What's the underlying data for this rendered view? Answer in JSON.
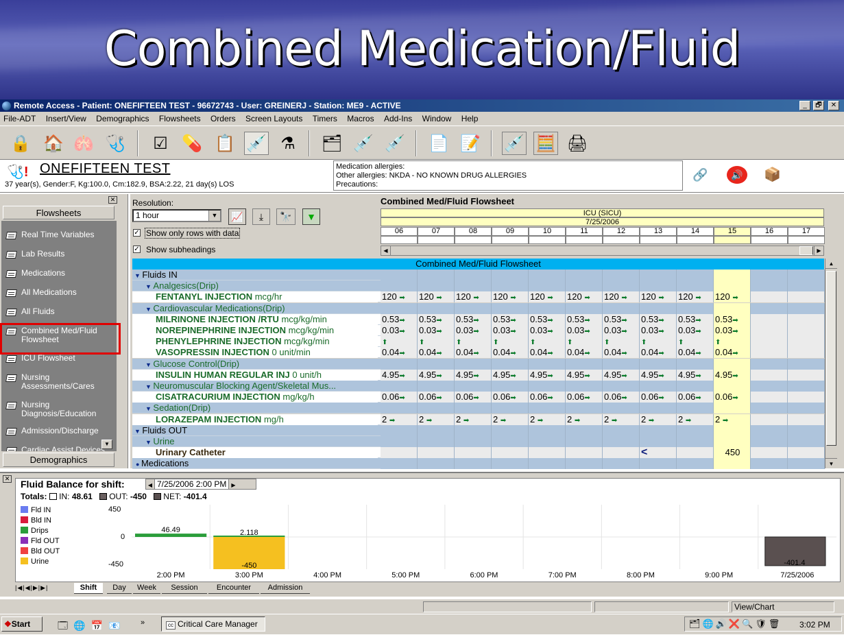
{
  "slide": {
    "title": "Combined Medication/Fluid"
  },
  "window": {
    "title": "Remote Access - Patient: ONEFIFTEEN TEST - 96672743 - User: GREINERJ - Station: ME9 - ACTIVE",
    "min": "_",
    "max": "🗗",
    "close": "✕"
  },
  "menu": [
    "File-ADT",
    "Insert/View",
    "Demographics",
    "Flowsheets",
    "Orders",
    "Screen Layouts",
    "Timers",
    "Macros",
    "Add-Ins",
    "Window",
    "Help"
  ],
  "toolbar_icons": [
    {
      "name": "lock-icon",
      "glyph": "🔒"
    },
    {
      "name": "home-icon",
      "glyph": "🏠"
    },
    {
      "name": "lungs-icon",
      "glyph": "🫁"
    },
    {
      "name": "stethoscope-icon",
      "glyph": "🩺"
    },
    {
      "name": "checklist-icon",
      "glyph": "☑"
    },
    {
      "name": "pills-icon",
      "glyph": "💊"
    },
    {
      "name": "schedule-icon",
      "glyph": "📋"
    },
    {
      "name": "iv-icon",
      "glyph": "💉"
    },
    {
      "name": "lab-flask-icon",
      "glyph": "⚗"
    },
    {
      "name": "cards-icon",
      "glyph": "🗂"
    },
    {
      "name": "syringe-icon",
      "glyph": "💉"
    },
    {
      "name": "syringe-red-icon",
      "glyph": "💉"
    },
    {
      "name": "document-person-icon",
      "glyph": "📄"
    },
    {
      "name": "note-icon",
      "glyph": "📝"
    },
    {
      "name": "injection-icon",
      "glyph": "💉"
    },
    {
      "name": "calculator-icon",
      "glyph": "🧮"
    },
    {
      "name": "printer-icon",
      "glyph": "🖨"
    }
  ],
  "patient": {
    "name": "ONEFIFTEEN TEST",
    "info": "37 year(s), Gender:F, Kg:100.0, Cm:182.9, BSA:2.22, 21 day(s) LOS",
    "allergy_line1": "Medication allergies:",
    "allergy_line2": "Other allergies:  NKDA - NO KNOWN DRUG ALLERGIES",
    "allergy_line3": "Precautions:"
  },
  "sidebar": {
    "header": "Flowsheets",
    "items": [
      {
        "label": "Real Time Variables"
      },
      {
        "label": "Lab Results"
      },
      {
        "label": "Medications"
      },
      {
        "label": "All Medications"
      },
      {
        "label": "All Fluids"
      },
      {
        "label": "Combined Med/Fluid\nFlowsheet"
      },
      {
        "label": "ICU Flowsheet"
      },
      {
        "label": "Nursing\nAssessments/Cares"
      },
      {
        "label": "Nursing\nDiagnosis/Education"
      },
      {
        "label": "Admission/Discharge"
      },
      {
        "label": "Cardiac Assist Devices"
      }
    ],
    "footer": "Demographics"
  },
  "controls": {
    "resolution_label": "Resolution:",
    "resolution_value": "1 hour",
    "show_rows": "Show only rows with data",
    "show_subheadings": "Show subheadings",
    "checked": "✓"
  },
  "grid": {
    "title": "Combined Med/Fluid Flowsheet",
    "unit": "ICU (SICU)",
    "date": "7/25/2006",
    "hours": [
      "06",
      "07",
      "08",
      "09",
      "10",
      "11",
      "12",
      "13",
      "14",
      "15",
      "16",
      "17"
    ],
    "banner": "Combined Med/Fluid Flowsheet",
    "rows": [
      {
        "type": "group",
        "label": "Fluids IN",
        "values": []
      },
      {
        "type": "sub",
        "label": "Analgesics(Drip)",
        "values": []
      },
      {
        "type": "drug",
        "label": "FENTANYL INJECTION",
        "unit": " mcg/hr",
        "values": [
          "120 ➡",
          "120 ➡",
          "120 ➡",
          "120 ➡",
          "120 ➡",
          "120 ➡",
          "120 ➡",
          "120 ➡",
          "120 ➡",
          "120 ➡",
          "",
          ""
        ]
      },
      {
        "type": "sub",
        "label": "Cardiovascular Medications(Drip)",
        "values": []
      },
      {
        "type": "drug",
        "label": "MILRINONE INJECTION /RTU",
        "unit": " mcg/kg/min",
        "values": [
          "0.53➡",
          "0.53➡",
          "0.53➡",
          "0.53➡",
          "0.53➡",
          "0.53➡",
          "0.53➡",
          "0.53➡",
          "0.53➡",
          "0.53➡",
          "",
          ""
        ]
      },
      {
        "type": "drug",
        "label": "NOREPINEPHRINE INJECTION",
        "unit": " mcg/kg/min",
        "values": [
          "0.03➡",
          "0.03➡",
          "0.03➡",
          "0.03➡",
          "0.03➡",
          "0.03➡",
          "0.03➡",
          "0.03➡",
          "0.03➡",
          "0.03➡",
          "",
          ""
        ]
      },
      {
        "type": "drug",
        "label": "PHENYLEPHRINE INJECTION",
        "unit": " mcg/kg/min",
        "values": [
          "  ⬆",
          "  ⬆",
          "  ⬆",
          "  ⬆",
          "  ⬆",
          "  ⬆",
          "  ⬆",
          "  ⬆",
          "  ⬆",
          "  ⬆",
          "",
          ""
        ]
      },
      {
        "type": "drug",
        "label": "VASOPRESSIN INJECTION",
        "unit": " 0 unit/min",
        "values": [
          "0.04➡",
          "0.04➡",
          "0.04➡",
          "0.04➡",
          "0.04➡",
          "0.04➡",
          "0.04➡",
          "0.04➡",
          "0.04➡",
          "0.04➡",
          "",
          ""
        ]
      },
      {
        "type": "sub",
        "label": "Glucose Control(Drip)",
        "values": []
      },
      {
        "type": "drug",
        "label": "INSULIN HUMAN REGULAR INJ",
        "unit": " 0 unit/h",
        "values": [
          "4.95➡",
          "4.95➡",
          "4.95➡",
          "4.95➡",
          "4.95➡",
          "4.95➡",
          "4.95➡",
          "4.95➡",
          "4.95➡",
          "4.95➡",
          "",
          ""
        ]
      },
      {
        "type": "sub",
        "label": "Neuromuscular Blocking Agent/Skeletal Mus...",
        "values": []
      },
      {
        "type": "drug",
        "label": "CISATRACURIUM INJECTION",
        "unit": " mg/kg/h",
        "values": [
          "0.06➡",
          "0.06➡",
          "0.06➡",
          "0.06➡",
          "0.06➡",
          "0.06➡",
          "0.06➡",
          "0.06➡",
          "0.06➡",
          "0.06➡",
          "",
          ""
        ]
      },
      {
        "type": "sub",
        "label": "Sedation(Drip)",
        "values": []
      },
      {
        "type": "drug",
        "label": "LORAZEPAM INJECTION",
        "unit": " mg/h",
        "values": [
          "2   ➡",
          "2   ➡",
          "2   ➡",
          "2   ➡",
          "2   ➡",
          "2   ➡",
          "2   ➡",
          "2   ➡",
          "2   ➡",
          "2   ➡",
          "",
          ""
        ]
      },
      {
        "type": "group",
        "label": "Fluids OUT",
        "values": []
      },
      {
        "type": "sub",
        "label": "Urine",
        "values": []
      },
      {
        "type": "out",
        "label": "Urinary Catheter",
        "unit": "",
        "values": [
          "",
          "",
          "",
          "",
          "",
          "",
          "",
          "   <",
          "",
          "450",
          "",
          ""
        ]
      },
      {
        "type": "group2",
        "label": "Medications",
        "values": []
      }
    ]
  },
  "balance": {
    "title": "Fluid Balance for shift:",
    "datetime": "7/25/2006 2:00 PM",
    "totals_label": "Totals:",
    "in_label": "IN:",
    "in_value": "48.61",
    "out_label": "OUT:",
    "out_value": "-450",
    "net_label": "NET:",
    "net_value": "-401.4"
  },
  "chart_data": {
    "type": "bar",
    "categories": [
      "2:00 PM",
      "3:00 PM",
      "4:00 PM",
      "5:00 PM",
      "6:00 PM",
      "7:00 PM",
      "8:00 PM",
      "9:00 PM",
      "7/25/2006"
    ],
    "ylim": [
      -450,
      450
    ],
    "yticks": [
      "450",
      "0",
      "-450"
    ],
    "legend": [
      {
        "name": "Fld IN",
        "color": "#6a7cf0"
      },
      {
        "name": "Bld IN",
        "color": "#d81b3c"
      },
      {
        "name": "Drips",
        "color": "#2a9d3a"
      },
      {
        "name": "Fld OUT",
        "color": "#8b2fb8"
      },
      {
        "name": "Bld OUT",
        "color": "#f04040"
      },
      {
        "name": "Urine",
        "color": "#f5c020"
      }
    ],
    "series": [
      {
        "name": "Drips",
        "values": [
          46.49,
          2.118,
          null,
          null,
          null,
          null,
          null,
          null,
          null
        ]
      },
      {
        "name": "Urine",
        "values": [
          null,
          -450,
          null,
          null,
          null,
          null,
          null,
          null,
          null
        ]
      }
    ],
    "net_bar": {
      "value": -401.4,
      "color": "#5a5050"
    },
    "labels": {
      "a": "46.49",
      "b": "2.118",
      "c": "-450",
      "d": "-401.4"
    }
  },
  "tabs": [
    "Shift",
    "Day",
    "Week",
    "Session",
    "Encounter",
    "Admission"
  ],
  "status": {
    "right": "View/Chart"
  },
  "taskbar": {
    "start": "Start",
    "app": "Critical Care Manager",
    "clock": "3:02 PM",
    "app_icon": "cc"
  }
}
